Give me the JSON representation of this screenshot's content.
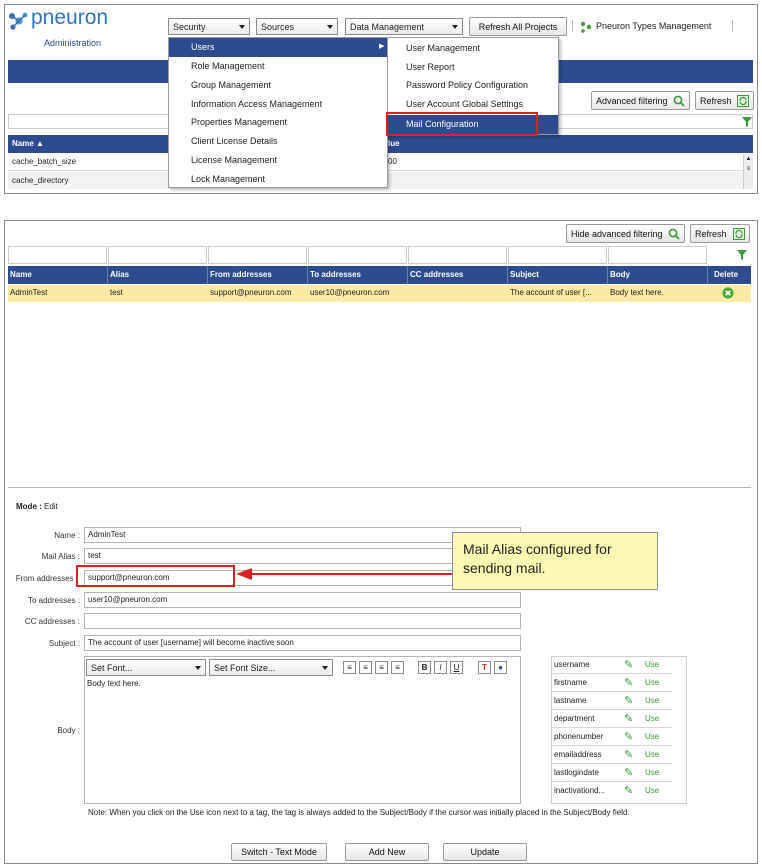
{
  "logo": {
    "brand": "pneuron",
    "subtitle": "Administration"
  },
  "topnav": {
    "security": "Security",
    "sources": "Sources",
    "data_management": "Data Management",
    "refresh_all": "Refresh All Projects",
    "types_management": "Pneuron Types Management"
  },
  "menu": {
    "items": [
      "Users",
      "Role Management",
      "Group Management",
      "Information Access Management",
      "Properties Management",
      "Client License Details",
      "License Management",
      "Lock Management"
    ],
    "submenu": [
      "User Management",
      "User Report",
      "Password Policy Configuration",
      "User Account Global Settings",
      "Mail Configuration"
    ]
  },
  "panel1": {
    "advanced_filtering": "Advanced filtering",
    "refresh": "Refresh",
    "col_name": "Name",
    "col_value_fragment": "lue",
    "rows": [
      {
        "name": "cache_batch_size",
        "value": "00"
      },
      {
        "name": "cache_directory",
        "value": ""
      }
    ]
  },
  "panel2": {
    "hide_filtering": "Hide advanced filtering",
    "refresh": "Refresh",
    "columns": [
      "Name",
      "Alias",
      "From addresses",
      "To addresses",
      "CC addresses",
      "Subject",
      "Body",
      "Delete"
    ],
    "row": {
      "name": "AdminTest",
      "alias": "test",
      "from": "support@pneuron.com",
      "to": "user10@pneuron.com",
      "cc": "",
      "subject": "The account of user [...",
      "body": "Body text here."
    }
  },
  "form": {
    "mode_label": "Mode :",
    "mode_value": "Edit",
    "labels": {
      "name": "Name :",
      "alias": "Mail Alias :",
      "from": "From addresses :",
      "to": "To addresses :",
      "cc": "CC addresses :",
      "subject": "Subject :",
      "body": "Body :"
    },
    "values": {
      "name": "AdminTest",
      "alias": "test",
      "from": "support@pneuron.com",
      "to": "user10@pneuron.com",
      "cc": "",
      "subject": "The account of user [username] will become inactive soon",
      "body": "Body text here."
    },
    "editor": {
      "font": "Set Font...",
      "font_size": "Set Font Size..."
    },
    "tags": [
      "username",
      "firstname",
      "lastname",
      "department",
      "phonenumber",
      "emailaddress",
      "lastlogindate",
      "inactivationd..."
    ],
    "use_label": "Use",
    "note": "Note: When you click on the Use icon next to a tag, the tag is always added to the Subject/Body if the cursor was initially placed in the Subject/Body field.",
    "buttons": {
      "switch": "Switch - Text Mode",
      "add": "Add New",
      "update": "Update"
    }
  },
  "callout": {
    "text": "Mail Alias configured for sending mail."
  },
  "colors": {
    "header_blue": "#2d4b8f",
    "highlight_row": "#fbe9a6",
    "annotation_red": "#e02020",
    "callout_bg": "#fcf9b4"
  }
}
